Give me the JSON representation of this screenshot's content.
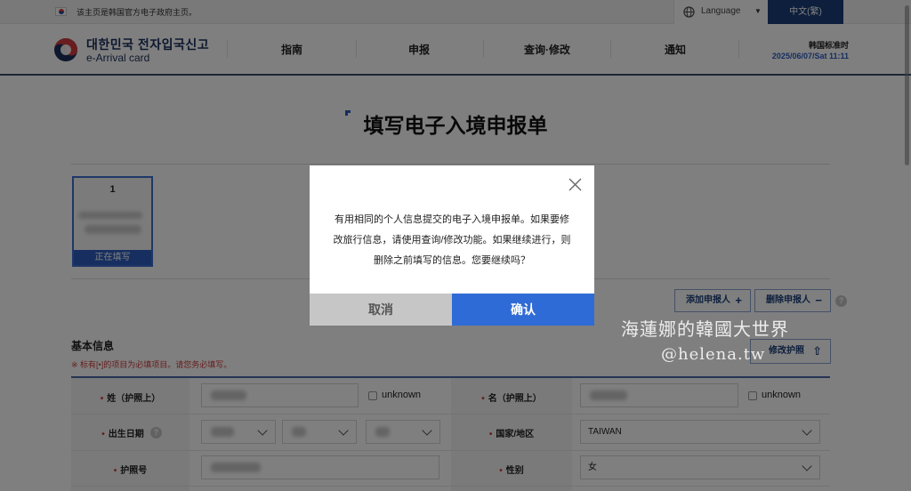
{
  "gov_bar": {
    "notice": "该主页是韩国官方电子政府主页。",
    "language_label": "Language",
    "current_language": "中文(繁)"
  },
  "header": {
    "logo_kr": "대한민국 전자입국신고",
    "logo_en": "e-Arrival card",
    "nav": [
      "指南",
      "申报",
      "查询·修改",
      "通知"
    ],
    "time_label": "韩国标准时",
    "time_value": "2025/06/07/Sat 11:11"
  },
  "page": {
    "title": "填写电子入境申报单",
    "person_number": "1",
    "person_status": "正在填写",
    "add_button": "添加申报人",
    "remove_button": "删除申报人",
    "section_title": "基本信息",
    "required_note": "※ 标有[•]的项目为必填项目。请您务必填写。",
    "edit_passport_button": "修改护照",
    "form": {
      "surname_label": "姓（护照上）",
      "given_name_label": "名（护照上）",
      "unknown_label": "unknown",
      "birth_label": "出生日期",
      "country_label": "国家/地区",
      "country_value": "TAIWAN",
      "passport_label": "护照号",
      "gender_label": "性别",
      "gender_value": "女"
    }
  },
  "modal": {
    "message_line1": "有用相同的个人信息提交的电子入境申报单。如果要修",
    "message_line2": "改旅行信息，请使用查询/修改功能。如果继续进行，则",
    "message_line3": "删除之前填写的信息。您要继续吗？",
    "cancel_label": "取消",
    "confirm_label": "确认"
  },
  "watermark": {
    "line1": "海蓮娜的韓國大世界",
    "line2": "@helena.tw"
  },
  "colors": {
    "brand_navy": "#1b3f7a",
    "accent_blue": "#2f6bd6",
    "required_red": "#d03a3a"
  }
}
